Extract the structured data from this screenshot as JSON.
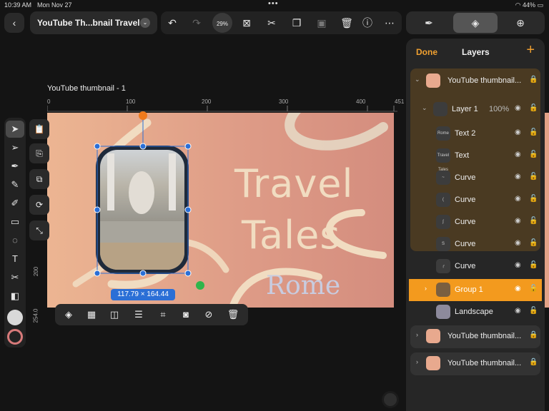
{
  "status_bar": {
    "time": "10:39 AM",
    "date": "Mon Nov 27",
    "battery": "44%"
  },
  "document": {
    "title": "YouTube Th...bnail Travel",
    "zoom": "29%",
    "artboard_label": "YouTube thumbnail - 1"
  },
  "toolbar": {
    "icons": [
      "undo-icon",
      "redo-icon",
      "zoom-indicator",
      "select-frame-icon",
      "scissors-icon",
      "duplicate-icon",
      "copy-style-icon",
      "trash-icon",
      "help-icon",
      "more-icon"
    ]
  },
  "right_tabs": [
    "pen-tab",
    "layers-tab",
    "add-tab"
  ],
  "rulers": {
    "h_labels": [
      "0",
      "100",
      "200",
      "300",
      "400",
      "451"
    ],
    "v_labels": [
      "200",
      "254.0"
    ]
  },
  "canvas": {
    "title_line1": "Travel",
    "title_line2": "Tales",
    "subtitle": "Rome"
  },
  "selection": {
    "dimensions": "117.79 × 164.44"
  },
  "layers_panel": {
    "done": "Done",
    "title": "Layers",
    "add": "+",
    "rows": [
      {
        "name": "YouTube thumbnail...",
        "indent": 0,
        "thumb": "",
        "style": "top"
      },
      {
        "name": "Layer 1",
        "indent": 1,
        "thumb": "Travel Tales",
        "opacity": "100%"
      },
      {
        "name": "Text 2",
        "indent": 2,
        "thumb": "Rome"
      },
      {
        "name": "Text",
        "indent": 2,
        "thumb": "Travel Tales"
      },
      {
        "name": "Curve",
        "indent": 2,
        "thumb": ""
      },
      {
        "name": "Curve",
        "indent": 2,
        "thumb": ""
      },
      {
        "name": "Curve",
        "indent": 2,
        "thumb": ""
      },
      {
        "name": "Curve",
        "indent": 2,
        "thumb": ""
      },
      {
        "name": "Curve",
        "indent": 2,
        "thumb": ""
      },
      {
        "name": "Group 1",
        "indent": 2,
        "thumb": "",
        "selected": true
      },
      {
        "name": "Landscape",
        "indent": 2,
        "thumb": ""
      },
      {
        "name": "YouTube thumbnail...",
        "indent": 0,
        "thumb": ""
      },
      {
        "name": "YouTube thumbnail...",
        "indent": 0,
        "thumb": ""
      }
    ]
  },
  "colors": {
    "accent": "#f0a030",
    "selection": "#2b6fd6"
  }
}
